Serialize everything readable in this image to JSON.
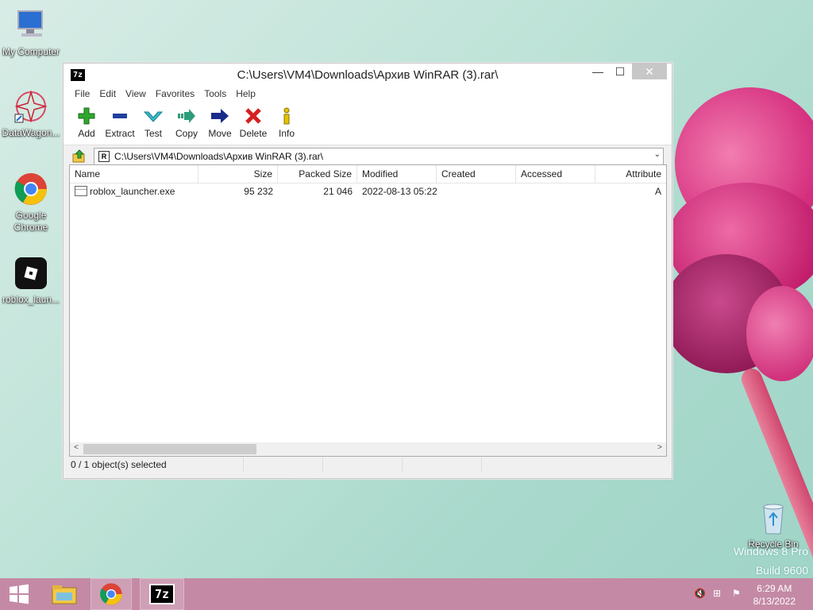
{
  "desktop": {
    "icons": [
      {
        "label": "My Computer"
      },
      {
        "label": "DataWagon..."
      },
      {
        "label": "Google Chrome"
      },
      {
        "label": "roblox_laun..."
      },
      {
        "label": "Recycle Bin"
      }
    ],
    "watermark": {
      "line1": "Windows 8 Pro",
      "line2": "Build 9600"
    }
  },
  "window": {
    "title": "C:\\Users\\VM4\\Downloads\\Архив WinRAR (3).rar\\",
    "app_icon": "7z",
    "controls": {
      "minimize": "—",
      "maximize": "☐",
      "close": "✕"
    },
    "menu": [
      "File",
      "Edit",
      "View",
      "Favorites",
      "Tools",
      "Help"
    ],
    "toolbar": [
      {
        "label": "Add",
        "icon": "plus-icon",
        "color": "#2fa82f"
      },
      {
        "label": "Extract",
        "icon": "minus-icon",
        "color": "#1f3f9f"
      },
      {
        "label": "Test",
        "icon": "check-icon",
        "color": "#39b8c8"
      },
      {
        "label": "Copy",
        "icon": "double-arrow-icon",
        "color": "#2e9c7a"
      },
      {
        "label": "Move",
        "icon": "arrow-right-icon",
        "color": "#1b2b8a"
      },
      {
        "label": "Delete",
        "icon": "x-icon",
        "color": "#d61f1f"
      },
      {
        "label": "Info",
        "icon": "info-icon",
        "color": "#c9a400"
      }
    ],
    "address": "C:\\Users\\VM4\\Downloads\\Архив WinRAR (3).rar\\",
    "columns": [
      "Name",
      "Size",
      "Packed Size",
      "Modified",
      "Created",
      "Accessed",
      "Attribute"
    ],
    "rows": [
      {
        "name": "roblox_launcher.exe",
        "size": "95 232",
        "packed": "21 046",
        "modified": "2022-08-13 05:22",
        "created": "",
        "accessed": "",
        "attr": "A"
      }
    ],
    "status": "0 / 1 object(s) selected"
  },
  "taskbar": {
    "time": "6:29 AM",
    "date": "8/13/2022",
    "accent": "#c48aa5"
  }
}
